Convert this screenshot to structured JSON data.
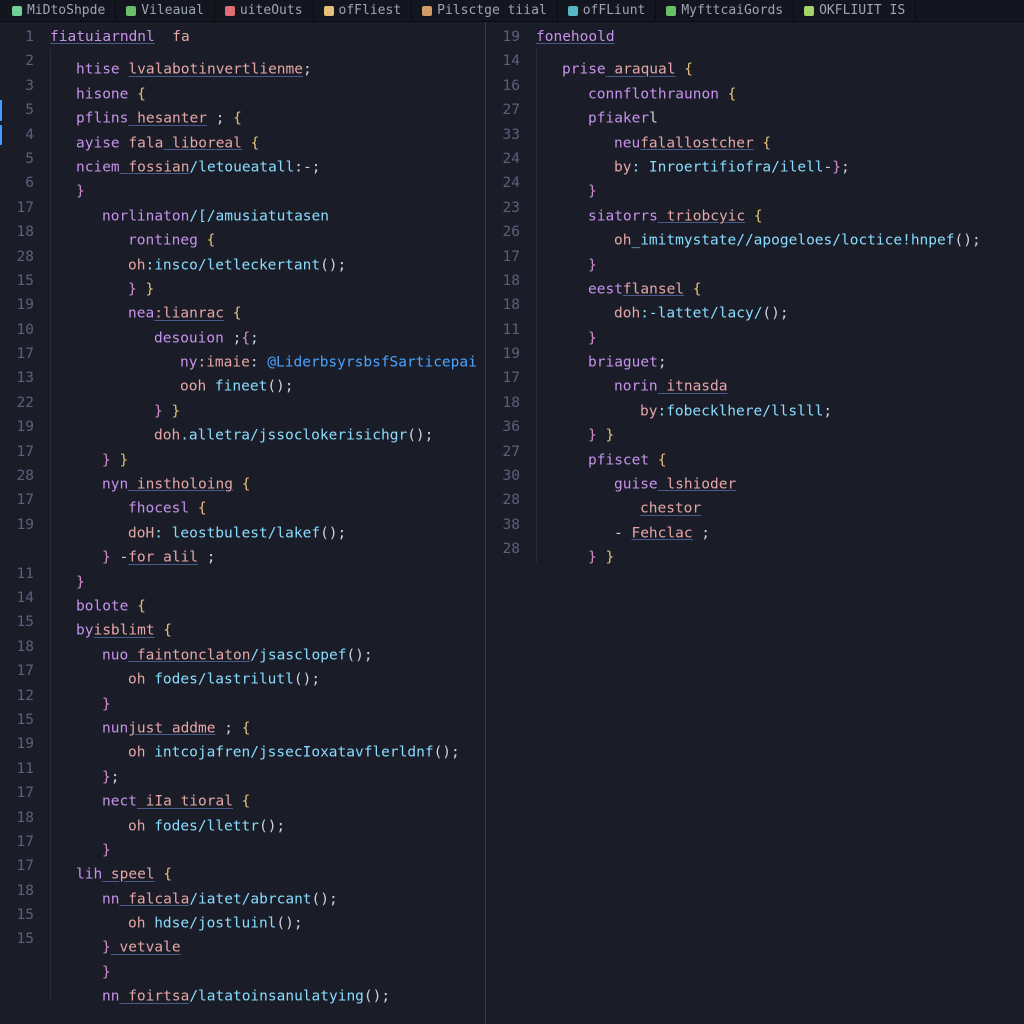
{
  "tabs": [
    {
      "icon_color": "#6fcf97",
      "label": "MiDtoShpde"
    },
    {
      "icon_color": "#6abf69",
      "label": "Vileaual"
    },
    {
      "icon_color": "#e06c75",
      "label": "uiteOuts"
    },
    {
      "icon_color": "#e5c07b",
      "label": "ofFliest"
    },
    {
      "icon_color": "#d19a66",
      "label": "Pilsctge tiial"
    },
    {
      "icon_color": "#56b6c2",
      "label": "ofFLiunt"
    },
    {
      "icon_color": "#6abf69",
      "label": "MyfttcaiGords"
    },
    {
      "icon_color": "#a5d46a",
      "label": "OKFLIUIT IS"
    }
  ],
  "left": {
    "line_numbers": [
      "1",
      "2",
      "3",
      "5",
      "4",
      "5",
      "6",
      "17",
      "18",
      "28",
      "15",
      "19",
      "10",
      "17",
      "13",
      "22",
      "19",
      "17",
      "28",
      "17",
      "19",
      "",
      "11",
      "14",
      "15",
      "18",
      "17",
      "12",
      "15",
      "19",
      "11",
      "17",
      "18",
      "17",
      "17",
      "18",
      "15",
      "15",
      ""
    ],
    "lines": [
      {
        "indent": 0,
        "tokens": [
          [
            "kw ul",
            "fiatuiarndnl"
          ],
          [
            "pun",
            "  "
          ],
          [
            "id",
            "fa"
          ],
          [
            "pun",
            ""
          ]
        ]
      },
      {
        "indent": 1,
        "tokens": [
          [
            "kw",
            "htise"
          ],
          [
            "pun",
            " "
          ],
          [
            "id ul",
            "lvalabotinvertlienme"
          ],
          [
            "pun",
            ";"
          ]
        ]
      },
      {
        "indent": 1,
        "tokens": [
          [
            "kw",
            "hisone"
          ],
          [
            "pun",
            ""
          ],
          [
            "brY",
            " {"
          ]
        ]
      },
      {
        "indent": 1,
        "tokens": [
          [
            "kw",
            "pflins"
          ],
          [
            "id ul",
            " hesanter"
          ],
          [
            "pun",
            " ;"
          ],
          [
            "brY",
            " {"
          ]
        ]
      },
      {
        "indent": 1,
        "tokens": [
          [
            "kw",
            "ayise"
          ],
          [
            "id",
            " fala"
          ],
          [
            "id ul",
            " liboreal"
          ],
          [
            "brY",
            " {"
          ]
        ]
      },
      {
        "indent": 1,
        "tokens": [
          [
            "kw",
            "nciem"
          ],
          [
            "id ul",
            " fossian"
          ],
          [
            "call",
            "/letoueatall"
          ],
          [
            "pun",
            ":-;"
          ]
        ]
      },
      {
        "indent": 1,
        "tokens": [
          [
            "brP",
            "}"
          ]
        ]
      },
      {
        "indent": 2,
        "tokens": [
          [
            "kw",
            "norlinaton"
          ],
          [
            "call",
            "/[/amusiatutasen"
          ]
        ]
      },
      {
        "indent": 3,
        "tokens": [
          [
            "kw",
            "rontineg"
          ],
          [
            "pun",
            ""
          ],
          [
            "brY",
            " {"
          ]
        ]
      },
      {
        "indent": 3,
        "tokens": [
          [
            "id",
            "oh"
          ],
          [
            "call",
            ":insco/letleckertant"
          ],
          [
            "pun",
            "();"
          ]
        ]
      },
      {
        "indent": 3,
        "tokens": [
          [
            "brP",
            "}"
          ],
          [
            "brY",
            " }"
          ]
        ]
      },
      {
        "indent": 3,
        "tokens": [
          [
            "kw",
            "nea"
          ],
          [
            "id ul",
            ":lianrac"
          ],
          [
            "brY",
            " {"
          ]
        ]
      },
      {
        "indent": 4,
        "tokens": [
          [
            "kw",
            "desouion"
          ],
          [
            "pun",
            " ;"
          ],
          [
            "brP",
            "{"
          ],
          [
            "pun",
            ";"
          ]
        ]
      },
      {
        "indent": 5,
        "tokens": [
          [
            "kw",
            "ny"
          ],
          [
            "id",
            ":imaie"
          ],
          [
            "pun",
            ": "
          ],
          [
            "ann",
            "@LiderbsyrsbsfSarticepai"
          ]
        ]
      },
      {
        "indent": 5,
        "tokens": [
          [
            "id",
            "ooh"
          ],
          [
            "call",
            " fineet"
          ],
          [
            "pun",
            "();"
          ]
        ]
      },
      {
        "indent": 4,
        "tokens": [
          [
            "brP",
            "}"
          ],
          [
            "brY",
            " }"
          ]
        ]
      },
      {
        "indent": 4,
        "tokens": [
          [
            "id",
            "doh"
          ],
          [
            "call",
            ".alletra/jssoclokerisichgr"
          ],
          [
            "pun",
            "();"
          ]
        ]
      },
      {
        "indent": 2,
        "tokens": [
          [
            "brP",
            "}"
          ],
          [
            "brY",
            " }"
          ]
        ]
      },
      {
        "indent": 2,
        "tokens": [
          [
            "kw",
            "nyn"
          ],
          [
            "id ul",
            " instholoing"
          ],
          [
            "brY",
            " {"
          ]
        ]
      },
      {
        "indent": 3,
        "tokens": [
          [
            "kw",
            "fhocesl"
          ],
          [
            "brY",
            " {"
          ]
        ]
      },
      {
        "indent": 3,
        "tokens": [
          [
            "id",
            "doH"
          ],
          [
            "call",
            ": leostbulest/lakef"
          ],
          [
            "pun",
            "();"
          ]
        ]
      },
      {
        "indent": 2,
        "tokens": [
          [
            "brP",
            "}"
          ],
          [
            "pun",
            " -"
          ],
          [
            "id ul",
            "for alil"
          ],
          [
            "pun",
            " ;"
          ]
        ]
      },
      {
        "indent": 1,
        "tokens": [
          [
            "brP",
            "}"
          ]
        ]
      },
      {
        "indent": 1,
        "tokens": [
          [
            "kw",
            "bolote"
          ],
          [
            "brY",
            " {"
          ]
        ]
      },
      {
        "indent": 1,
        "tokens": [
          [
            "kw",
            "by"
          ],
          [
            "id ul",
            "isblimt"
          ],
          [
            "brY",
            " {"
          ]
        ]
      },
      {
        "indent": 2,
        "tokens": [
          [
            "kw",
            "nuo"
          ],
          [
            "id ul",
            " faintonclaton"
          ],
          [
            "call",
            "/jsasclopef"
          ],
          [
            "pun",
            "();"
          ]
        ]
      },
      {
        "indent": 3,
        "tokens": [
          [
            "id",
            "oh"
          ],
          [
            "call",
            " fodes/lastrilutl"
          ],
          [
            "pun",
            "();"
          ]
        ]
      },
      {
        "indent": 2,
        "tokens": [
          [
            "brP",
            "}"
          ]
        ]
      },
      {
        "indent": 2,
        "tokens": [
          [
            "kw",
            "nun"
          ],
          [
            "id ul",
            "just addme"
          ],
          [
            "pun",
            " ;"
          ],
          [
            "brY",
            " {"
          ]
        ]
      },
      {
        "indent": 3,
        "tokens": [
          [
            "id",
            "oh"
          ],
          [
            "call",
            " intcojafren/jssecIoxatavflerldnf"
          ],
          [
            "pun",
            "();"
          ]
        ]
      },
      {
        "indent": 2,
        "tokens": [
          [
            "brP",
            "}"
          ],
          [
            "pun",
            ";"
          ]
        ]
      },
      {
        "indent": 2,
        "tokens": [
          [
            "kw",
            "nect"
          ],
          [
            "id ul",
            " iIa tioral"
          ],
          [
            "brY",
            " {"
          ]
        ]
      },
      {
        "indent": 3,
        "tokens": [
          [
            "id",
            "oh"
          ],
          [
            "call",
            " fodes/llettr"
          ],
          [
            "pun",
            "();"
          ]
        ]
      },
      {
        "indent": 2,
        "tokens": [
          [
            "brP",
            "}"
          ]
        ]
      },
      {
        "indent": 1,
        "tokens": [
          [
            "kw",
            "lih"
          ],
          [
            "id ul",
            " speel"
          ],
          [
            "brY",
            " {"
          ]
        ]
      },
      {
        "indent": 2,
        "tokens": [
          [
            "kw",
            "nn"
          ],
          [
            "id ul",
            " falcala"
          ],
          [
            "call",
            "/iatet/abrcant"
          ],
          [
            "pun",
            "();"
          ]
        ]
      },
      {
        "indent": 3,
        "tokens": [
          [
            "id",
            "oh"
          ],
          [
            "call",
            " hdse/jostluinl"
          ],
          [
            "pun",
            "();"
          ]
        ]
      },
      {
        "indent": 2,
        "tokens": [
          [
            "brP",
            "}"
          ],
          [
            "id ul",
            " vetvale"
          ],
          [
            "pun",
            ""
          ]
        ]
      },
      {
        "indent": 2,
        "tokens": [
          [
            "brP",
            "}"
          ]
        ]
      },
      {
        "indent": 2,
        "tokens": [
          [
            "kw",
            "nn"
          ],
          [
            "id ul",
            " foirtsa"
          ],
          [
            "call",
            "/latatoinsanulatying"
          ],
          [
            "pun",
            "();"
          ]
        ]
      }
    ],
    "gutter_marks": {
      "4": "blue",
      "5": "blue"
    }
  },
  "right": {
    "line_numbers": [
      "19",
      "14",
      "16",
      "27",
      "33",
      "24",
      "24",
      "23",
      "26",
      "17",
      "18",
      "18",
      "11",
      "19",
      "17",
      "18",
      "36",
      "27",
      "30",
      "28",
      "38",
      "28"
    ],
    "lines": [
      {
        "indent": 0,
        "tokens": [
          [
            "kw ul",
            "fonehoold"
          ]
        ]
      },
      {
        "indent": 1,
        "tokens": [
          [
            "kw",
            "prise"
          ],
          [
            "id ul",
            " araqual"
          ],
          [
            "brY",
            " {"
          ]
        ]
      },
      {
        "indent": 2,
        "tokens": [
          [
            "kw",
            "connflothraunon"
          ],
          [
            "brY",
            " {"
          ]
        ]
      },
      {
        "indent": 2,
        "tokens": [
          [
            "kw",
            "pfiaker"
          ],
          [
            "pun",
            "l"
          ]
        ]
      },
      {
        "indent": 3,
        "tokens": [
          [
            "kw",
            "neu"
          ],
          [
            "id ul",
            "falallostcher"
          ],
          [
            "brY",
            " {"
          ]
        ]
      },
      {
        "indent": 3,
        "tokens": [
          [
            "id",
            "by"
          ],
          [
            "call",
            ": Inroertifiofra/ilell"
          ],
          [
            "pun",
            "-"
          ],
          [
            "brP",
            "}"
          ],
          [
            "pun",
            ";"
          ]
        ]
      },
      {
        "indent": 2,
        "tokens": [
          [
            "brP",
            "}"
          ]
        ]
      },
      {
        "indent": 2,
        "tokens": [
          [
            "kw",
            "siatorrs"
          ],
          [
            "id ul",
            " triobcyic"
          ],
          [
            "brY",
            " {"
          ]
        ]
      },
      {
        "indent": 3,
        "tokens": [
          [
            "id",
            "oh"
          ],
          [
            "call",
            "_imitmystate//apogeloes/loctice!hnpef"
          ],
          [
            "pun",
            "();"
          ]
        ]
      },
      {
        "indent": 2,
        "tokens": [
          [
            "brP",
            "}"
          ]
        ]
      },
      {
        "indent": 2,
        "tokens": [
          [
            "kw",
            "eest"
          ],
          [
            "id ul",
            "flansel"
          ],
          [
            "brY",
            " {"
          ]
        ]
      },
      {
        "indent": 3,
        "tokens": [
          [
            "id",
            "doh"
          ],
          [
            "call",
            ":-lattet/lacy/"
          ],
          [
            "pun",
            "();"
          ]
        ]
      },
      {
        "indent": 2,
        "tokens": [
          [
            "brP",
            "}"
          ]
        ]
      },
      {
        "indent": 2,
        "tokens": [
          [
            "kw",
            "briaguet"
          ],
          [
            "pun",
            ";"
          ]
        ]
      },
      {
        "indent": 3,
        "tokens": [
          [
            "kw",
            "norin"
          ],
          [
            "id ul",
            " itnasda"
          ]
        ]
      },
      {
        "indent": 4,
        "tokens": [
          [
            "id",
            "by"
          ],
          [
            "call",
            ":fobecklhere/llslll"
          ],
          [
            "pun",
            ";"
          ]
        ]
      },
      {
        "indent": 2,
        "tokens": [
          [
            "brP",
            "}"
          ],
          [
            "brY",
            " }"
          ]
        ]
      },
      {
        "indent": 2,
        "tokens": [
          [
            "kw",
            "pfiscet"
          ],
          [
            "brY",
            " {"
          ]
        ]
      },
      {
        "indent": 3,
        "tokens": [
          [
            "kw",
            "guise"
          ],
          [
            "id ul",
            " lshioder"
          ]
        ]
      },
      {
        "indent": 4,
        "tokens": [
          [
            "id ul",
            "chestor"
          ]
        ]
      },
      {
        "indent": 3,
        "tokens": [
          [
            "pun",
            "- "
          ],
          [
            "id ul",
            "Fehclac"
          ],
          [
            "pun",
            " ;"
          ]
        ]
      },
      {
        "indent": 2,
        "tokens": [
          [
            "brP",
            "}"
          ],
          [
            "brY",
            " }"
          ]
        ]
      }
    ]
  }
}
